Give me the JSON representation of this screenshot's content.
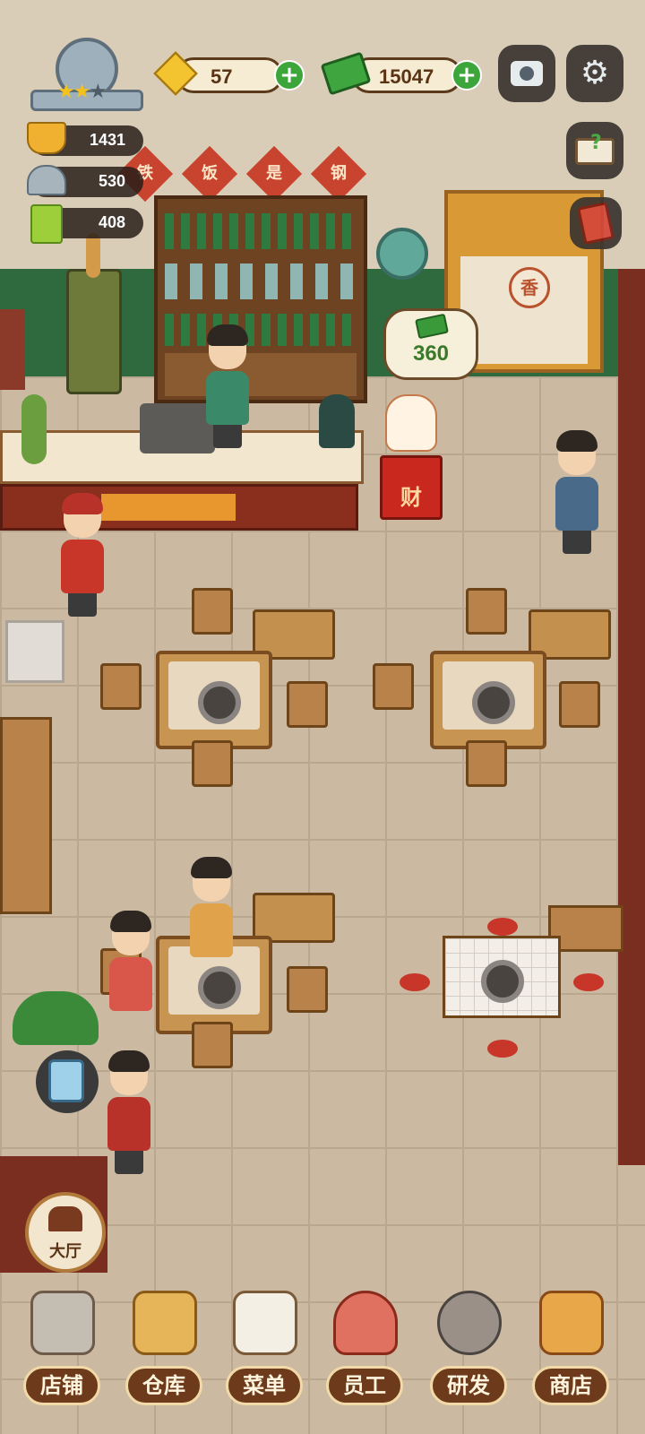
{
  "hud": {
    "level_stars_filled": 2,
    "level_stars_total": 3,
    "gems": "57",
    "cash": "15047",
    "stats": [
      {
        "icon": "hotpot-icon",
        "value": "1431"
      },
      {
        "icon": "cloche-icon",
        "value": "530"
      },
      {
        "icon": "recipe-book-icon",
        "value": "408"
      }
    ],
    "icons": {
      "camera": "camera-icon",
      "settings": "gear-icon",
      "help": "help-book-icon",
      "guide": "guide-book-icon"
    }
  },
  "wall_calligraphy": [
    "铁",
    "饭",
    "是",
    "钢"
  ],
  "door_sign": "香",
  "fortune_box_label": "财",
  "coin_bubble": "360",
  "hall_button": "大厅",
  "bottom_nav": [
    {
      "label": "店铺",
      "icon": "shop-building-icon"
    },
    {
      "label": "仓库",
      "icon": "warehouse-boxes-icon"
    },
    {
      "label": "菜单",
      "icon": "menu-clipboard-icon"
    },
    {
      "label": "员工",
      "icon": "staff-chef-icon"
    },
    {
      "label": "研发",
      "icon": "research-wok-icon"
    },
    {
      "label": "商店",
      "icon": "store-icon"
    }
  ],
  "colors": {
    "accent_green": "#3da63a",
    "nav_brown": "#6d3b1c",
    "calligraphy_red": "#c8442f",
    "wall_green": "#2f6a3e"
  }
}
